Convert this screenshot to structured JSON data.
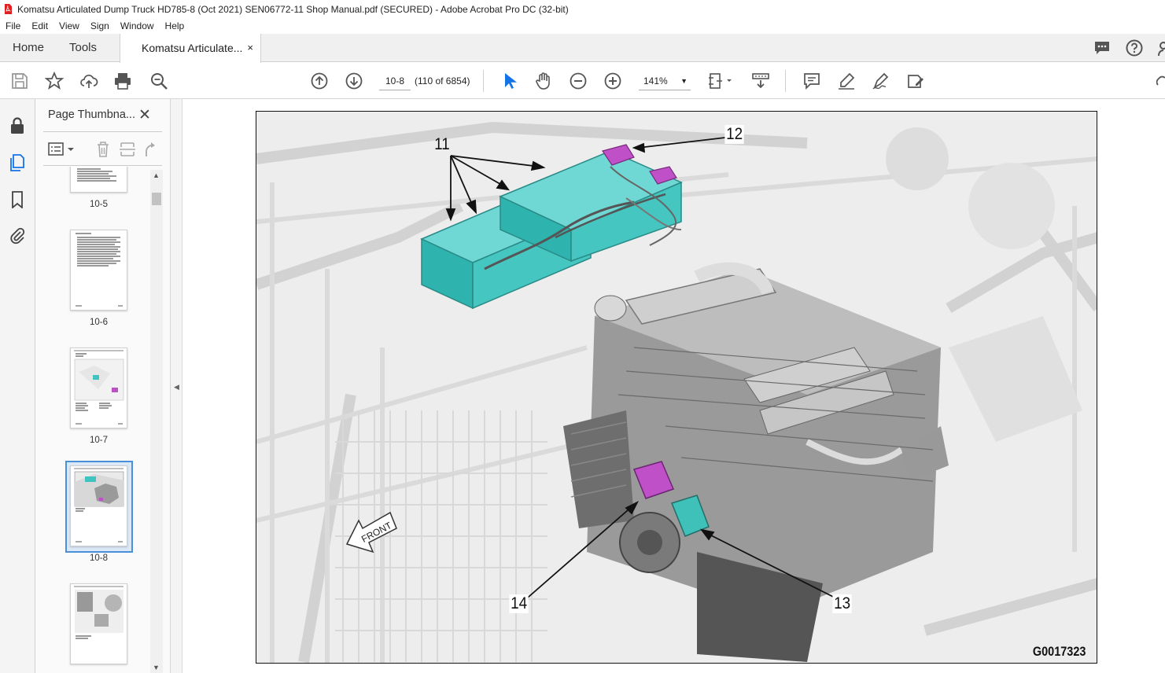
{
  "window": {
    "title": "Komatsu Articulated Dump Truck HD785-8 (Oct 2021) SEN06772-11 Shop Manual.pdf (SECURED) - Adobe Acrobat Pro DC (32-bit)"
  },
  "menubar": {
    "items": [
      "File",
      "Edit",
      "View",
      "Sign",
      "Window",
      "Help"
    ]
  },
  "tabs": {
    "home": "Home",
    "tools": "Tools",
    "document": "Komatsu Articulate...",
    "close": "×"
  },
  "toolbar": {
    "page_input": "10-8",
    "page_count": "(110 of 6854)",
    "zoom": "141%"
  },
  "thumbnail_pane": {
    "title": "Page Thumbna...",
    "close": "✕",
    "pages": [
      {
        "label": "10-5"
      },
      {
        "label": "10-6"
      },
      {
        "label": "10-7"
      },
      {
        "label": "10-8"
      },
      {
        "label": ""
      }
    ]
  },
  "document": {
    "figure_code": "G0017323",
    "callouts": [
      "11",
      "12",
      "13",
      "14"
    ],
    "front_label": "FRONT",
    "colors": {
      "battery": "#3fc4c0",
      "controller_magenta": "#c050c8",
      "controller_teal": "#3fc0b8"
    }
  },
  "colors": {
    "accent": "#4a90d9",
    "pdf_red": "#e02020"
  }
}
